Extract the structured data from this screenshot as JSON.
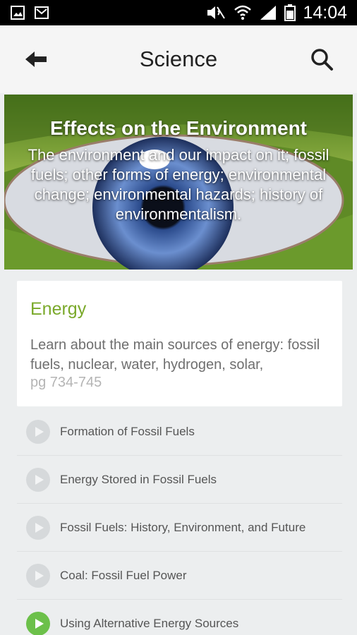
{
  "status_bar": {
    "time": "14:04",
    "icons": [
      "gallery-icon",
      "mail-icon",
      "mute-icon",
      "wifi-icon",
      "signal-icon",
      "battery-icon"
    ]
  },
  "app_bar": {
    "title": "Science",
    "back_icon": "arrow-left-icon",
    "search_icon": "search-icon"
  },
  "hero": {
    "title": "Effects on the Environment",
    "description": "The environment and our impact on it; fossil fuels; other forms of energy; environmental change; environmental hazards; history of environmentalism."
  },
  "card": {
    "title": "Energy",
    "description": "Learn about the main sources of energy: fossil fuels, nuclear, water, hydrogen, solar,",
    "pages": "pg 734-745"
  },
  "lessons": [
    {
      "label": "Formation of Fossil Fuels",
      "active": false
    },
    {
      "label": "Energy Stored in Fossil Fuels",
      "active": false
    },
    {
      "label": "Fossil Fuels: History, Environment, and Future",
      "active": false
    },
    {
      "label": "Coal: Fossil Fuel Power",
      "active": false
    },
    {
      "label": "Using Alternative Energy Sources",
      "active": true
    }
  ],
  "colors": {
    "accent_green": "#7aa92a",
    "play_active": "#6cc04a",
    "play_inactive": "#d6d9db"
  }
}
